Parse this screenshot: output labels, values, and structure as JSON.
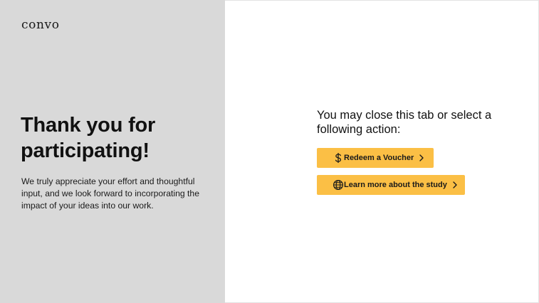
{
  "app": {
    "logo_text": "convo"
  },
  "left_panel": {
    "headline": "Thank you for participating!",
    "body": "We truly appreciate your effort and thoughtful input, and we look forward to incorporating the impact of your ideas into our work."
  },
  "right_panel": {
    "prompt": "You may close this tab or select a following action:",
    "actions": [
      {
        "label": "Redeem a Voucher",
        "icon": "dollar-icon"
      },
      {
        "label": "Learn more about the study",
        "icon": "globe-icon"
      }
    ]
  },
  "colors": {
    "left_panel_bg": "#d9d9d9",
    "button_bg": "#fbbf45",
    "text": "#111111"
  }
}
